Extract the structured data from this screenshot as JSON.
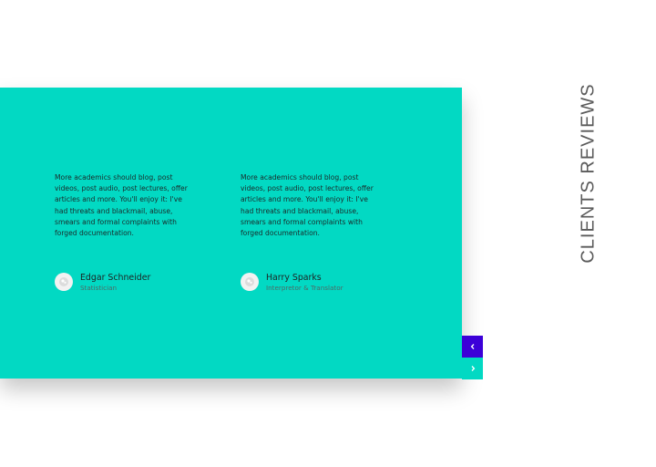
{
  "section": {
    "title": "CLIENTS REVIEWS"
  },
  "reviews": [
    {
      "quote": "More academics should blog, post videos, post audio, post lectures, offer articles and more. You'll enjoy it: I've had threats and blackmail, abuse, smears and formal complaints with forged documentation.",
      "name": "Edgar Schneider",
      "role": "Statistician"
    },
    {
      "quote": "More academics should blog, post videos, post audio, post lectures, offer articles and more. You'll enjoy it: I've had threats and blackmail, abuse, smears and formal complaints with forged documentation.",
      "name": "Harry Sparks",
      "role": "Interpretor & Translator"
    }
  ],
  "navigation": {
    "prev_icon": "chevron-left-icon",
    "next_icon": "chevron-right-icon"
  },
  "colors": {
    "panel": "#02d9c3",
    "nav_prev": "#3c00d8",
    "title": "#5a5a5a"
  }
}
